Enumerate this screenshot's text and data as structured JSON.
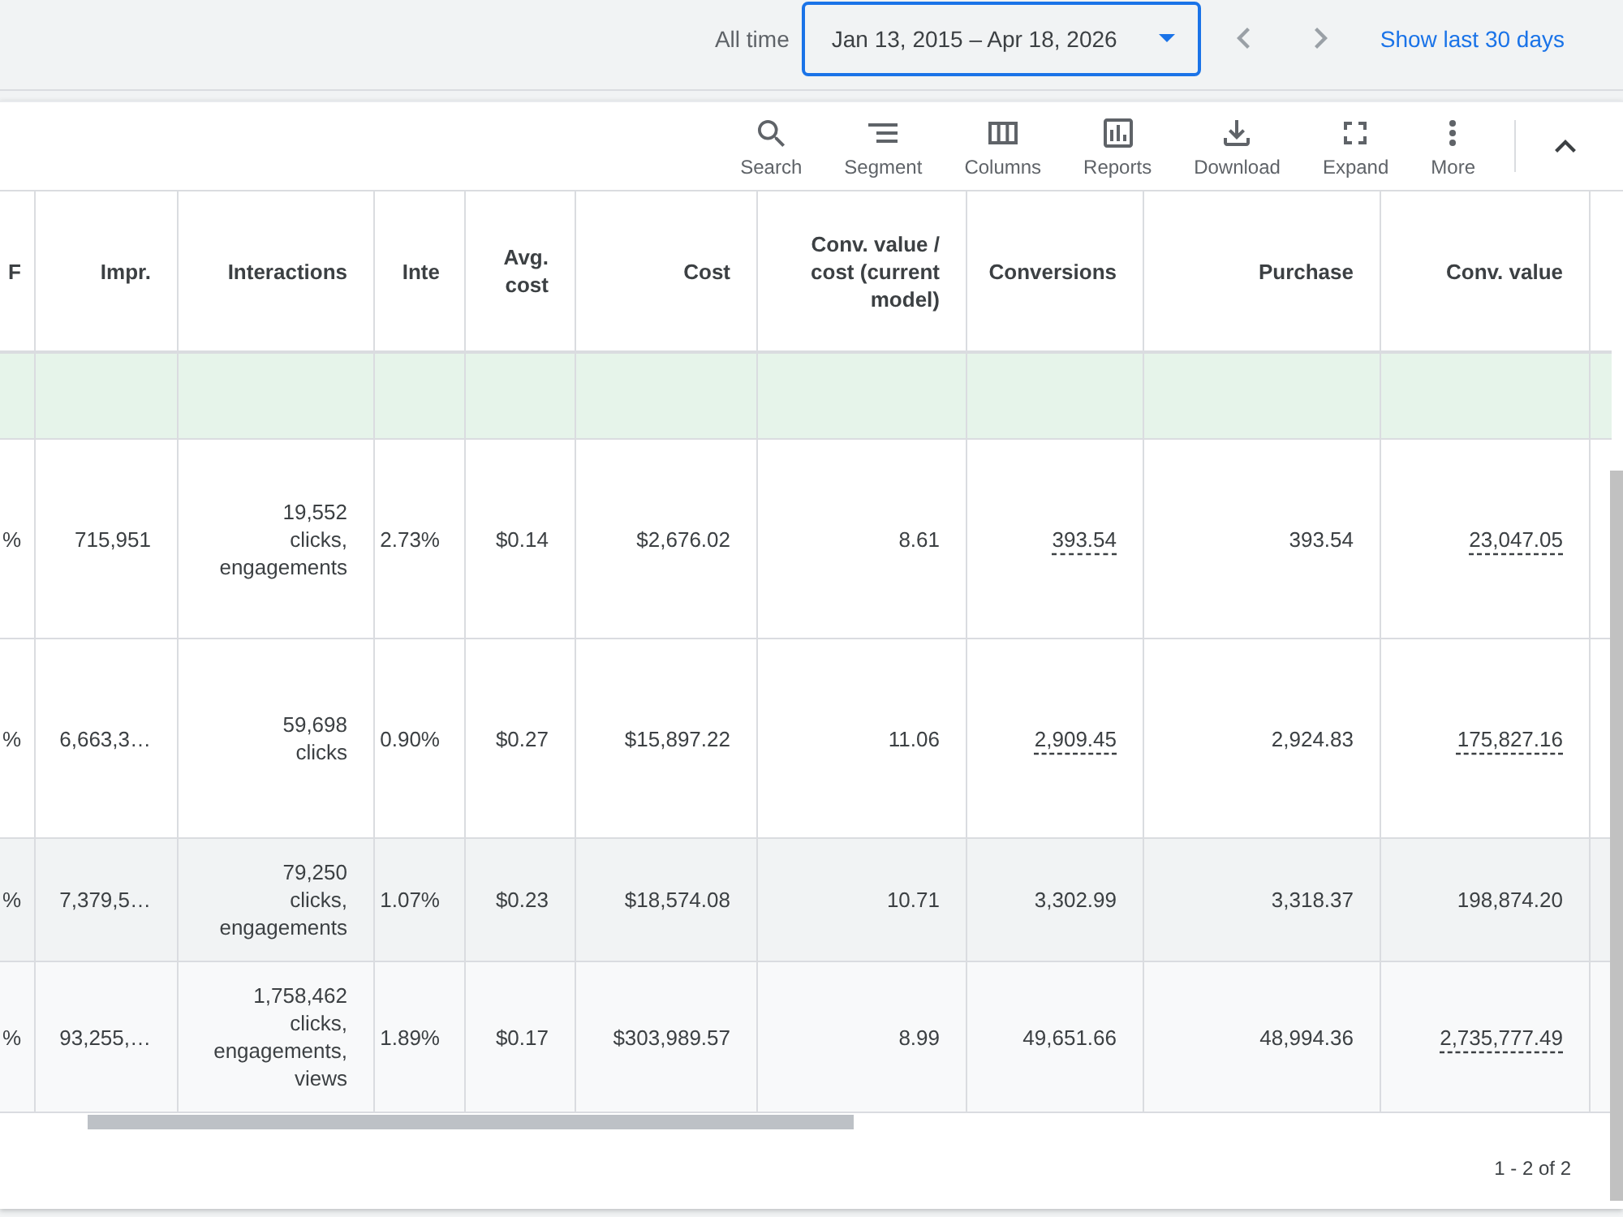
{
  "header": {
    "range_label": "All time",
    "date_range": {
      "value": "Jan 13, 2015 – Apr 18, 2026"
    },
    "nav_buttons": [
      {
        "disabled": true
      },
      {
        "disabled": true
      }
    ],
    "link": "Show last 30 days"
  },
  "toolbar": {
    "tools": [
      {
        "label": "Search"
      },
      {
        "label": "Segment"
      },
      {
        "label": "Columns"
      },
      {
        "label": "Reports"
      },
      {
        "label": "Download"
      },
      {
        "label": "Expand"
      },
      {
        "label": "More"
      }
    ]
  },
  "table": {
    "columns": [
      {
        "label": "F"
      },
      {
        "label": "Impr."
      },
      {
        "label": "Interactions"
      },
      {
        "label": "Inte"
      },
      {
        "label": "Avg. cost"
      },
      {
        "label": "Cost"
      },
      {
        "label": "Conv. value / cost (current model)"
      },
      {
        "label": "Conversions"
      },
      {
        "label": "Purchase"
      },
      {
        "label": "Conv. value"
      }
    ],
    "rows": [
      {
        "kind": "highlight"
      },
      {
        "kind": "data",
        "cells": [
          {
            "text": "%",
            "underlined": false
          },
          {
            "text": "715,951",
            "underlined": false
          },
          {
            "text": "19,552\nclicks, engagements",
            "underlined": false
          },
          {
            "text": "2.73%",
            "underlined": false
          },
          {
            "text": "$0.14",
            "underlined": false
          },
          {
            "text": "$2,676.02",
            "underlined": false
          },
          {
            "text": "8.61",
            "underlined": false
          },
          {
            "text": "393.54",
            "underlined": true
          },
          {
            "text": "393.54",
            "underlined": false
          },
          {
            "text": "23,047.05",
            "underlined": true
          }
        ]
      },
      {
        "kind": "data",
        "cells": [
          {
            "text": "%",
            "underlined": false
          },
          {
            "text": "6,663,3…",
            "underlined": false
          },
          {
            "text": "59,698\nclicks",
            "underlined": false
          },
          {
            "text": "0.90%",
            "underlined": false
          },
          {
            "text": "$0.27",
            "underlined": false
          },
          {
            "text": "$15,897.22",
            "underlined": false
          },
          {
            "text": "11.06",
            "underlined": false
          },
          {
            "text": "2,909.45",
            "underlined": true
          },
          {
            "text": "2,924.83",
            "underlined": false
          },
          {
            "text": "175,827.16",
            "underlined": true
          }
        ]
      },
      {
        "kind": "subtotal",
        "cells": [
          {
            "text": "%",
            "underlined": false
          },
          {
            "text": "7,379,5…",
            "underlined": false
          },
          {
            "text": "79,250\nclicks, engagements",
            "underlined": false
          },
          {
            "text": "1.07%",
            "underlined": false
          },
          {
            "text": "$0.23",
            "underlined": false
          },
          {
            "text": "$18,574.08",
            "underlined": false
          },
          {
            "text": "10.71",
            "underlined": false
          },
          {
            "text": "3,302.99",
            "underlined": false
          },
          {
            "text": "3,318.37",
            "underlined": false
          },
          {
            "text": "198,874.20",
            "underlined": false
          }
        ]
      },
      {
        "kind": "total",
        "cells": [
          {
            "text": "%",
            "underlined": false
          },
          {
            "text": "93,255,…",
            "underlined": false
          },
          {
            "text": "1,758,462\nclicks, engagements, views",
            "underlined": false
          },
          {
            "text": "1.89%",
            "underlined": false
          },
          {
            "text": "$0.17",
            "underlined": false
          },
          {
            "text": "$303,989.57",
            "underlined": false
          },
          {
            "text": "8.99",
            "underlined": false
          },
          {
            "text": "49,651.66",
            "underlined": false
          },
          {
            "text": "48,994.36",
            "underlined": false
          },
          {
            "text": "2,735,777.49",
            "underlined": true
          }
        ]
      }
    ]
  },
  "pagination": "1 - 2 of 2"
}
